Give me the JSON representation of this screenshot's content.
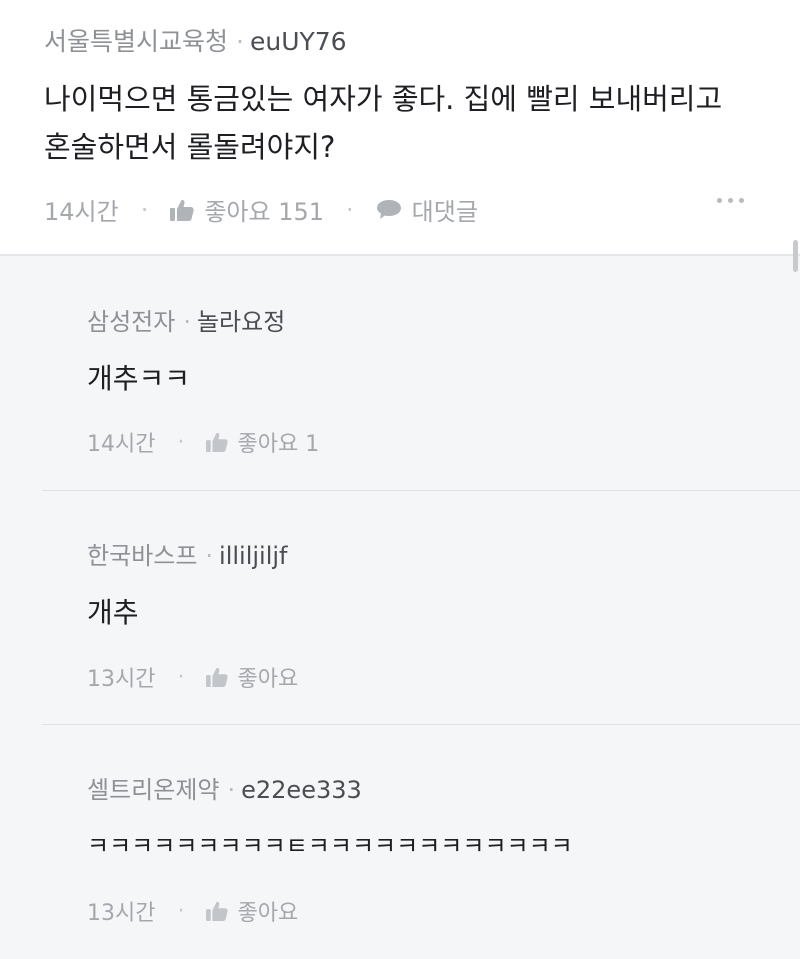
{
  "main_comment": {
    "org": "서울특별시교육청",
    "nickname": "euUY76",
    "text_line1": "나이먹으면 통금있는 여자가 좋다. 집에 빨리 보내버리고",
    "text_line2": "혼술하면서 롤돌려야지?",
    "time": "14시간",
    "like_label": "좋아요 151",
    "reply_label": "대댓글",
    "like_icon": "thumbs-up-icon",
    "reply_icon": "speech-bubble-icon",
    "more_icon": "more-dots-icon"
  },
  "replies": [
    {
      "org": "삼성전자",
      "nickname": "놀라요정",
      "text": "개추ㅋㅋ",
      "time": "14시간",
      "like_label": "좋아요 1"
    },
    {
      "org": "한국바스프",
      "nickname": "illiljiljf",
      "text": "개추",
      "time": "13시간",
      "like_label": "좋아요"
    },
    {
      "org": "셀트리온제약",
      "nickname": "e22ee333",
      "text": "ㅋㅋㅋㅋㅋㅋㅋㅋㅋㅌㅋㅋㅋㅋㅋㅋㅋㅋㅋㅋㅋㅋ",
      "time": "13시간",
      "like_label": "좋아요"
    }
  ],
  "separator": "·",
  "colors": {
    "background": "#f5f6f8",
    "card": "#ffffff",
    "text": "#1e1f22",
    "muted": "#8e9196"
  }
}
